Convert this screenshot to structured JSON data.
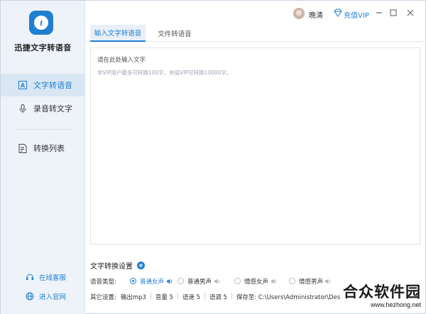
{
  "app": {
    "title": "迅捷文字转语音"
  },
  "nav": {
    "items": [
      {
        "label": "文字转语音",
        "icon": "text-to-speech-icon",
        "active": true
      },
      {
        "label": "录音转文字",
        "icon": "microphone-icon",
        "active": false
      },
      {
        "label": "转换列表",
        "icon": "list-icon",
        "active": false
      }
    ],
    "bottom": [
      {
        "label": "在线客服",
        "icon": "headset-icon"
      },
      {
        "label": "进入官网",
        "icon": "globe-icon"
      }
    ]
  },
  "topbar": {
    "username": "晚清",
    "vip_label": "充值VIP",
    "vip_icon": "diamond-icon"
  },
  "tabs": [
    {
      "label": "输入文字转语音",
      "active": true
    },
    {
      "label": "文件转语音",
      "active": false
    }
  ],
  "editor": {
    "placeholder": "请在此处输入文字",
    "hint": "非VIP用户最多可转换100字，充值VIP可转换10000字。"
  },
  "settings": {
    "title": "文字转换设置",
    "voice_type_label": "语音类型:",
    "voices": [
      {
        "label": "普通女声",
        "selected": true
      },
      {
        "label": "普通男声",
        "selected": false
      },
      {
        "label": "情感女声",
        "selected": false
      },
      {
        "label": "情感男声",
        "selected": false
      }
    ],
    "other_label": "其它设置:",
    "other_values": [
      "输出mp3",
      "音量 5",
      "语速 5",
      "语调 5",
      "保存至: C:\\Users\\Administrator\\Des"
    ]
  },
  "watermark": {
    "text": "合众软件园",
    "url": "www.hezhong.net"
  },
  "colors": {
    "accent": "#1f7fd1",
    "sidebar_bg": "#eef3f9",
    "active_bg": "#d9e6f3"
  }
}
